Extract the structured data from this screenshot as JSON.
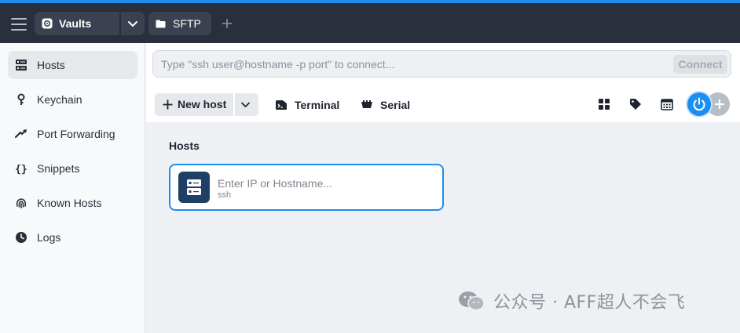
{
  "titlebar": {
    "vaults_label": "Vaults",
    "sftp_label": "SFTP"
  },
  "sidebar": {
    "items": [
      {
        "label": "Hosts",
        "icon": "server-icon",
        "active": true
      },
      {
        "label": "Keychain",
        "icon": "key-icon"
      },
      {
        "label": "Port Forwarding",
        "icon": "port-forward-icon"
      },
      {
        "label": "Snippets",
        "icon": "braces-icon"
      },
      {
        "label": "Known Hosts",
        "icon": "fingerprint-icon"
      },
      {
        "label": "Logs",
        "icon": "clock-icon"
      }
    ]
  },
  "connect": {
    "placeholder": "Type \"ssh user@hostname -p port\" to connect...",
    "button_label": "Connect"
  },
  "toolbar": {
    "new_host_label": "New host",
    "terminal_label": "Terminal",
    "serial_label": "Serial"
  },
  "hosts": {
    "section_title": "Hosts",
    "card_placeholder": "Enter IP or Hostname...",
    "card_subtitle": "ssh"
  },
  "watermark": {
    "text": "公众号 · AFF超人不会飞"
  },
  "colors": {
    "accent": "#1b8ef0",
    "titlebar": "#2a2f3d",
    "host_icon_bg": "#1e3f66"
  }
}
